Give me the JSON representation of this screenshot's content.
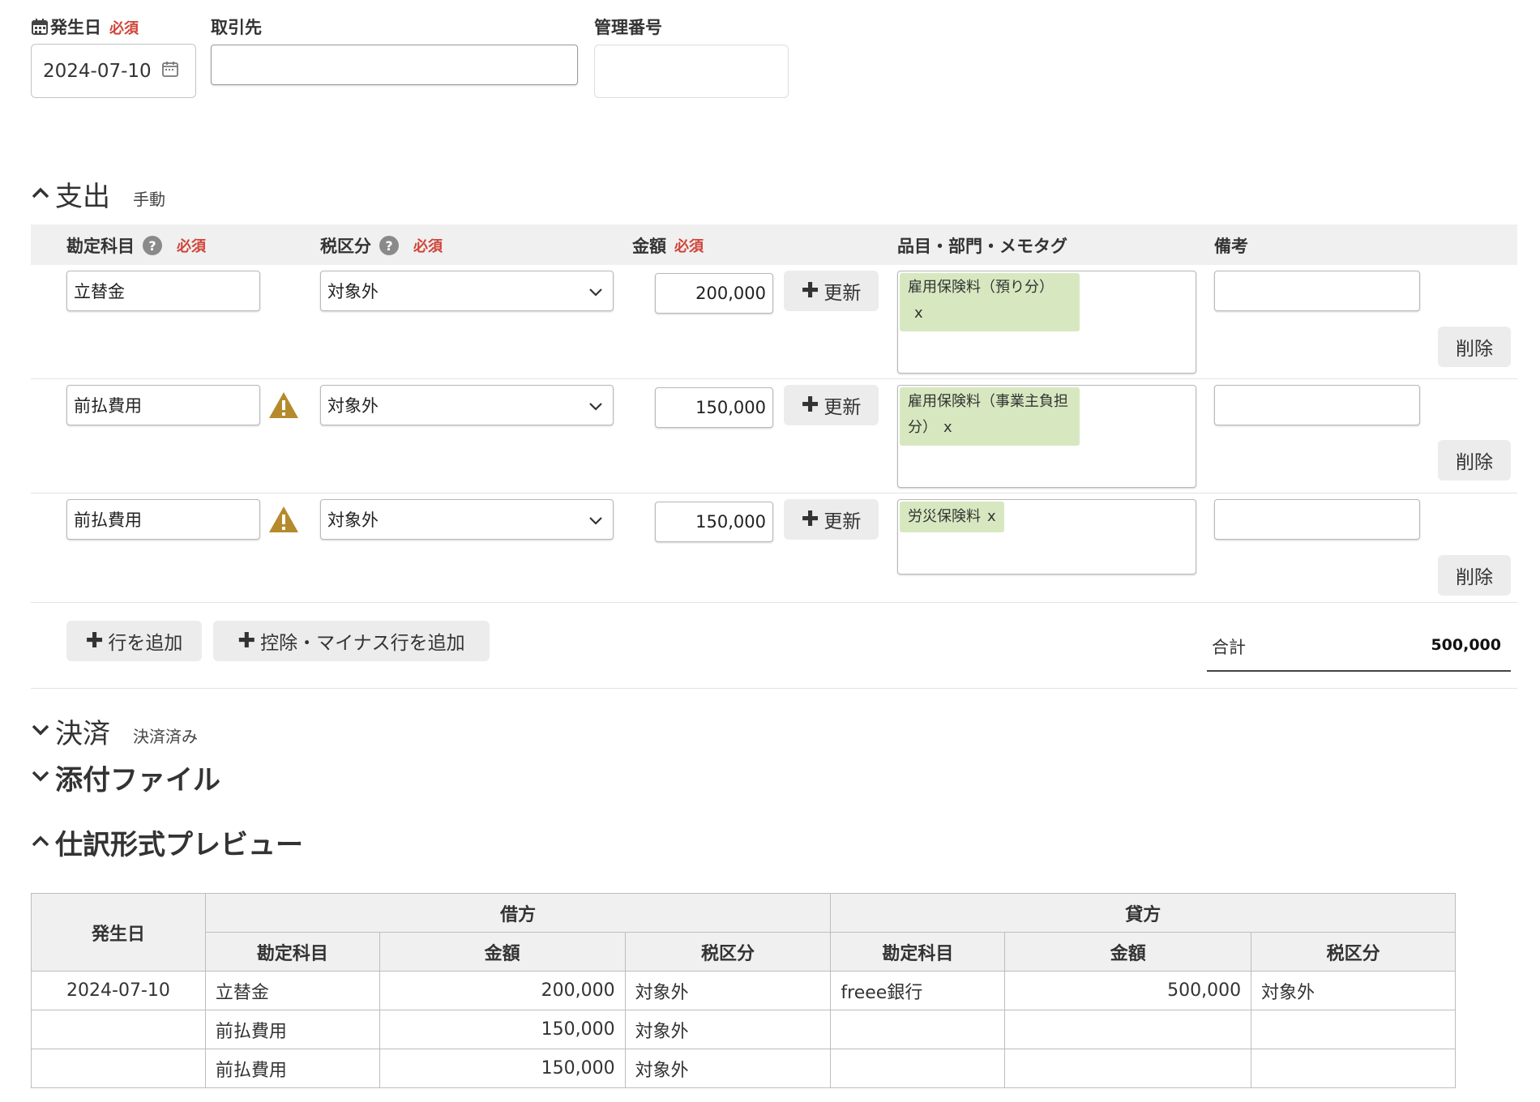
{
  "header": {
    "date_label": "発生日",
    "date_required": "必須",
    "date_value": "2024-07-10",
    "partner_label": "取引先",
    "partner_value": "",
    "manage_no_label": "管理番号",
    "manage_no_value": ""
  },
  "expense": {
    "title": "支出",
    "mode": "手動",
    "columns": {
      "account": "勘定科目",
      "tax": "税区分",
      "amount": "金額",
      "tags": "品目・部門・メモタグ",
      "memo": "備考",
      "required": "必須"
    },
    "update_label": "更新",
    "delete_label": "削除",
    "rows": [
      {
        "account": "立替金",
        "warning": false,
        "tax": "対象外",
        "amount": "200,000",
        "tag": "雇用保険料（預り分）",
        "tag_x": "x",
        "memo": ""
      },
      {
        "account": "前払費用",
        "warning": true,
        "tax": "対象外",
        "amount": "150,000",
        "tag": "雇用保険料（事業主負担分）",
        "tag_x": "x",
        "memo": ""
      },
      {
        "account": "前払費用",
        "warning": true,
        "tax": "対象外",
        "amount": "150,000",
        "tag": "労災保険料",
        "tag_x": "x",
        "memo": ""
      }
    ],
    "add_row_label": "行を追加",
    "add_deduct_label": "控除・マイナス行を追加",
    "total_label": "合計",
    "total_value": "500,000"
  },
  "settlement": {
    "title": "決済",
    "status": "決済済み"
  },
  "attachments": {
    "title": "添付ファイル"
  },
  "preview": {
    "title": "仕訳形式プレビュー",
    "headers": {
      "date": "発生日",
      "debit": "借方",
      "credit": "貸方",
      "account": "勘定科目",
      "amount": "金額",
      "tax": "税区分"
    },
    "rows": [
      {
        "date": "2024-07-10",
        "debit_account": "立替金",
        "debit_amount": "200,000",
        "debit_tax": "対象外",
        "credit_account": "freee銀行",
        "credit_amount": "500,000",
        "credit_tax": "対象外"
      },
      {
        "date": "",
        "debit_account": "前払費用",
        "debit_amount": "150,000",
        "debit_tax": "対象外",
        "credit_account": "",
        "credit_amount": "",
        "credit_tax": ""
      },
      {
        "date": "",
        "debit_account": "前払費用",
        "debit_amount": "150,000",
        "debit_tax": "対象外",
        "credit_account": "",
        "credit_amount": "",
        "credit_tax": ""
      }
    ]
  },
  "colors": {
    "required": "#d0453a",
    "tag_bg": "#d7e8c0",
    "warning": "#b58a2c",
    "header_bg": "#f0f0f0"
  }
}
